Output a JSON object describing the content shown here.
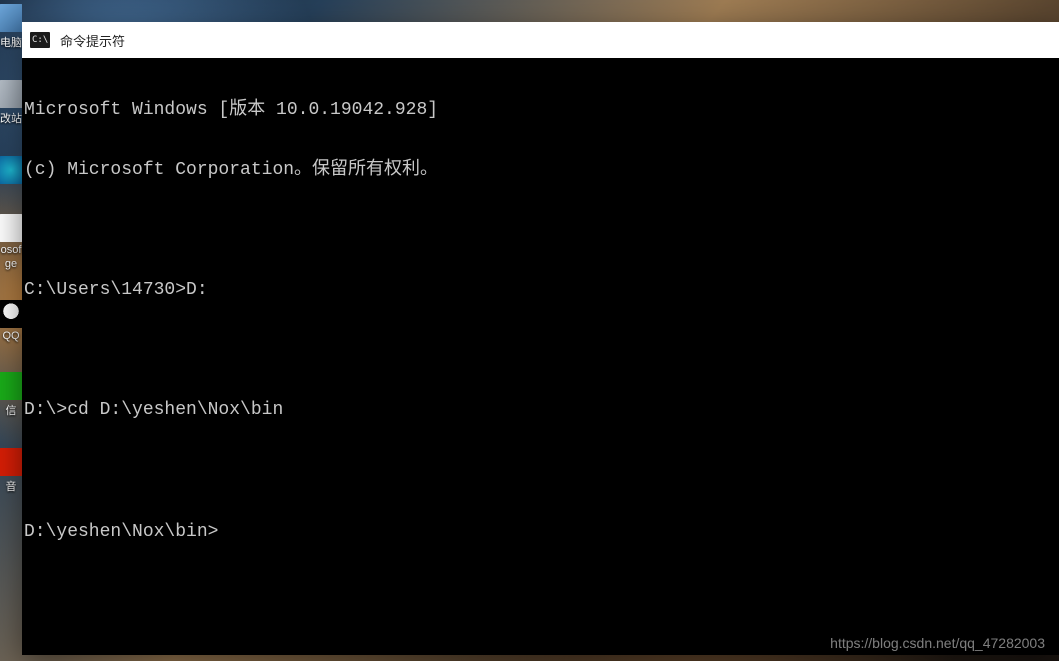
{
  "desktop": {
    "icons": [
      {
        "name": "computer-icon",
        "label": "电脑"
      },
      {
        "name": "recycle-bin-icon",
        "label": "改站"
      },
      {
        "name": "edge-icon",
        "label": ""
      },
      {
        "name": "ms-store-icon",
        "label": "osof"
      },
      {
        "name": "ms-store-sub",
        "label": "ge"
      },
      {
        "name": "qq-icon",
        "label": "QQ"
      },
      {
        "name": "wechat-icon",
        "label": "信"
      },
      {
        "name": "netease-icon",
        "label": "音"
      }
    ]
  },
  "window": {
    "title": "命令提示符",
    "icon_glyph": "C:\\"
  },
  "terminal": {
    "lines": [
      "Microsoft Windows [版本 10.0.19042.928]",
      "(c) Microsoft Corporation。保留所有权利。",
      "",
      "C:\\Users\\14730>D:",
      "",
      "D:\\>cd D:\\yeshen\\Nox\\bin",
      "",
      "D:\\yeshen\\Nox\\bin>"
    ]
  },
  "watermark": "https://blog.csdn.net/qq_47282003"
}
